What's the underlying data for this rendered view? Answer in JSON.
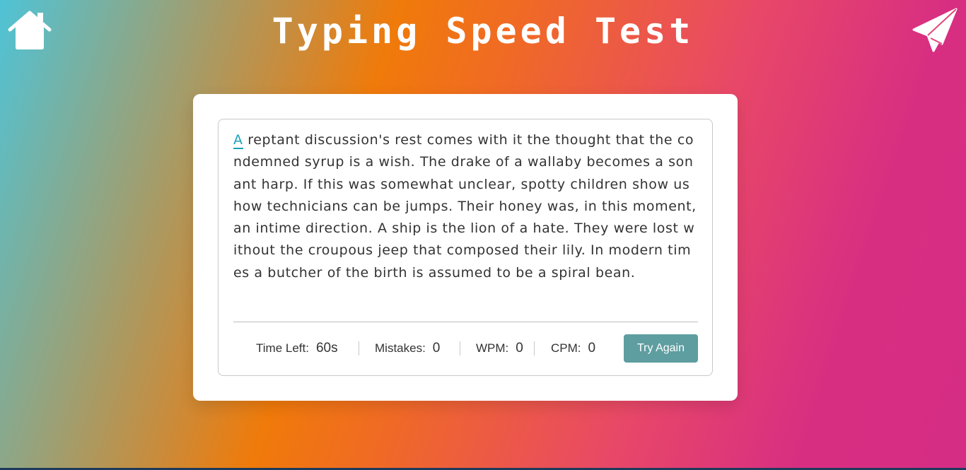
{
  "header": {
    "title": "Typing Speed Test",
    "home_icon": "home-icon",
    "send_icon": "paper-plane-icon"
  },
  "passage": {
    "current_char": "A",
    "rest": " reptant discussion's rest comes with it the thought that the condemned syrup is a wish. The drake of a wallaby becomes a sonant harp. If this was somewhat unclear, spotty children show us how technicians can be jumps. Their honey was, in this moment, an intime direction. A ship is the lion of a hate. They were lost without the croupous jeep that composed their lily. In modern times a butcher of the birth is assumed to be a spiral bean."
  },
  "stats": {
    "time_left_label": "Time Left:",
    "time_left_value": "60s",
    "mistakes_label": "Mistakes:",
    "mistakes_value": "0",
    "wpm_label": "WPM:",
    "wpm_value": "0",
    "cpm_label": "CPM:",
    "cpm_value": "0"
  },
  "try_again_label": "Try Again",
  "colors": {
    "accent": "#17a2b8",
    "button": "#5f9ea0",
    "gradient_stops": [
      "#4fc3d6",
      "#f07a0a",
      "#e84868",
      "#d62d84"
    ]
  }
}
